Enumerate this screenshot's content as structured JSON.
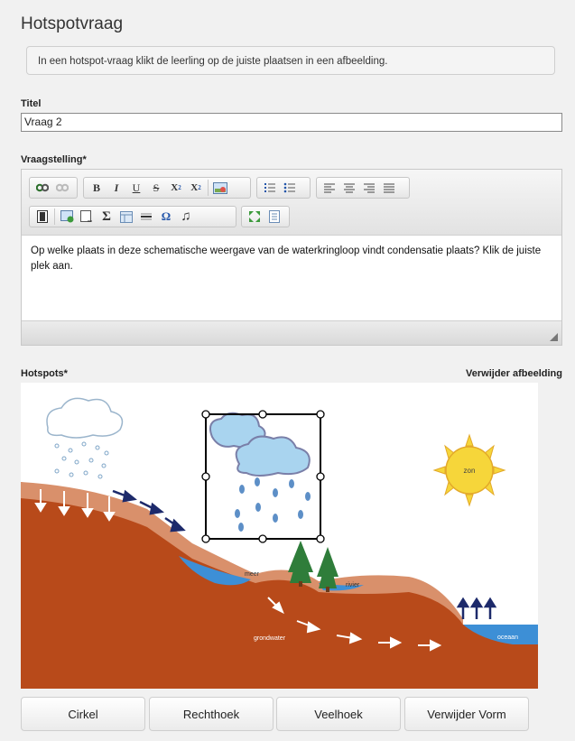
{
  "page": {
    "title": "Hotspotvraag",
    "info": "In een hotspot-vraag klikt de leerling op de juiste plaatsen in een afbeelding."
  },
  "form": {
    "titel_label": "Titel",
    "titel_value": "Vraag 2",
    "vraagstelling_label": "Vraagstelling*",
    "vraagstelling_text": "Op welke plaats in deze schematische weergave van de waterkringloop vindt condensatie plaats? Klik de juiste plek aan.",
    "hotspots_label": "Hotspots*",
    "remove_image": "Verwijder afbeelding"
  },
  "toolbar": {
    "row1": [
      "link-icon",
      "unlink-icon",
      "bold-icon",
      "italic-icon",
      "underline-icon",
      "strikethrough-icon",
      "subscript-icon",
      "superscript-icon",
      "image-icon",
      "ordered-list-icon",
      "unordered-list-icon",
      "align-left-icon",
      "align-center-icon",
      "align-right-icon",
      "justify-icon"
    ],
    "row2": [
      "video-icon",
      "insert-image-icon",
      "insert-page-icon",
      "sum-icon",
      "table-icon",
      "horizontal-rule-icon",
      "omega-icon",
      "music-icon",
      "fullscreen-icon",
      "source-icon"
    ]
  },
  "diagram": {
    "labels": {
      "zon": "zon",
      "meer": "meer",
      "rivier": "rivier",
      "grondwater": "grondwater",
      "oceaan": "oceaan"
    },
    "colors": {
      "soil": "#b84a1a",
      "topsoil": "#d9906b",
      "water": "#3d8fd6",
      "cloud": "#a9d4ef",
      "sun": "#f6d63a",
      "arrow_dark": "#1d2a6b",
      "tree": "#2f7d3a"
    }
  },
  "buttons": {
    "circle": "Cirkel",
    "rectangle": "Rechthoek",
    "polygon": "Veelhoek",
    "remove_shape": "Verwijder Vorm"
  }
}
